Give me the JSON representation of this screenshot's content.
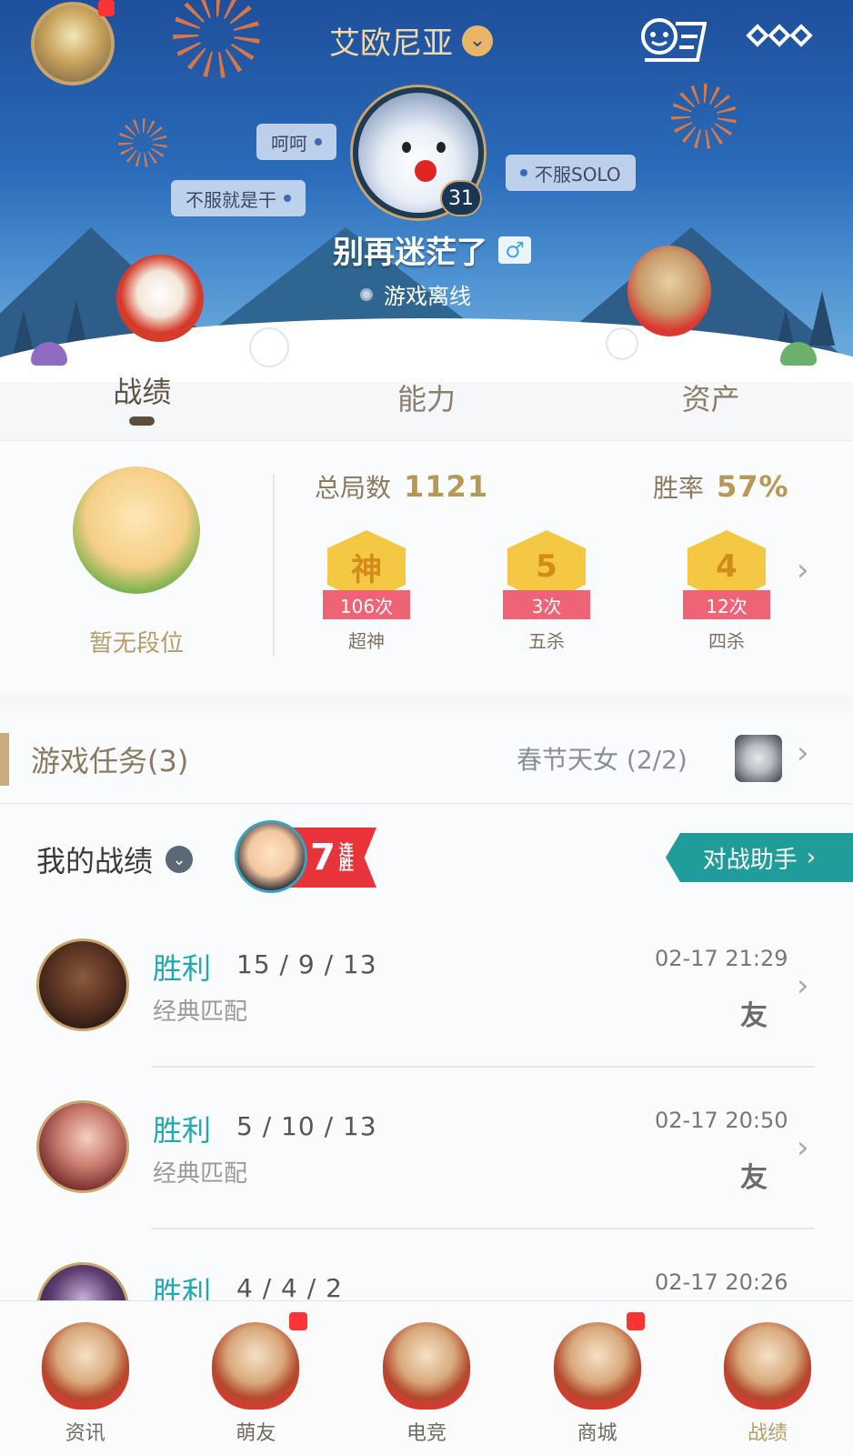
{
  "header": {
    "server_name": "艾欧尼亚",
    "player_level": "31",
    "username": "别再迷茫了",
    "gender_symbol": "♂",
    "status_text": "游戏离线",
    "bubbles": [
      "呵呵",
      "不服就是干",
      "不服SOLO"
    ]
  },
  "tabs": [
    {
      "label": "战绩",
      "active": true
    },
    {
      "label": "能力",
      "active": false
    },
    {
      "label": "资产",
      "active": false
    }
  ],
  "stats": {
    "rank_label": "暂无段位",
    "total_games_label": "总局数",
    "total_games": "1121",
    "win_rate_label": "胜率",
    "win_rate": "57%",
    "badges": [
      {
        "glyph": "神",
        "count": "106次",
        "name": "超神"
      },
      {
        "glyph": "5",
        "count": "3次",
        "name": "五杀"
      },
      {
        "glyph": "4",
        "count": "12次",
        "name": "四杀"
      }
    ]
  },
  "quest": {
    "title": "游戏任务(3)",
    "event": "春节天女 (2/2)"
  },
  "record": {
    "title": "我的战绩",
    "streak_number": "7",
    "streak_text": "连胜",
    "assistant_label": "对战助手"
  },
  "matches": [
    {
      "result": "胜利",
      "kda": "15 / 9 / 13",
      "mode": "经典匹配",
      "time": "02-17 21:29",
      "friend": "友"
    },
    {
      "result": "胜利",
      "kda": "5 / 10 / 13",
      "mode": "经典匹配",
      "time": "02-17 20:50",
      "friend": "友"
    },
    {
      "result": "胜利",
      "kda": "4 / 4 / 2",
      "mode": "",
      "time": "02-17 20:26",
      "friend": ""
    }
  ],
  "bottom_nav": [
    {
      "label": "资讯",
      "badge": false
    },
    {
      "label": "萌友",
      "badge": true
    },
    {
      "label": "电竞",
      "badge": false
    },
    {
      "label": "商城",
      "badge": true
    },
    {
      "label": "战绩",
      "badge": false,
      "active": true
    }
  ],
  "colors": {
    "accent_teal": "#209c9a",
    "win_text": "#1fa8b0",
    "gold_text": "#b99755",
    "badge_red": "#ee6476"
  }
}
